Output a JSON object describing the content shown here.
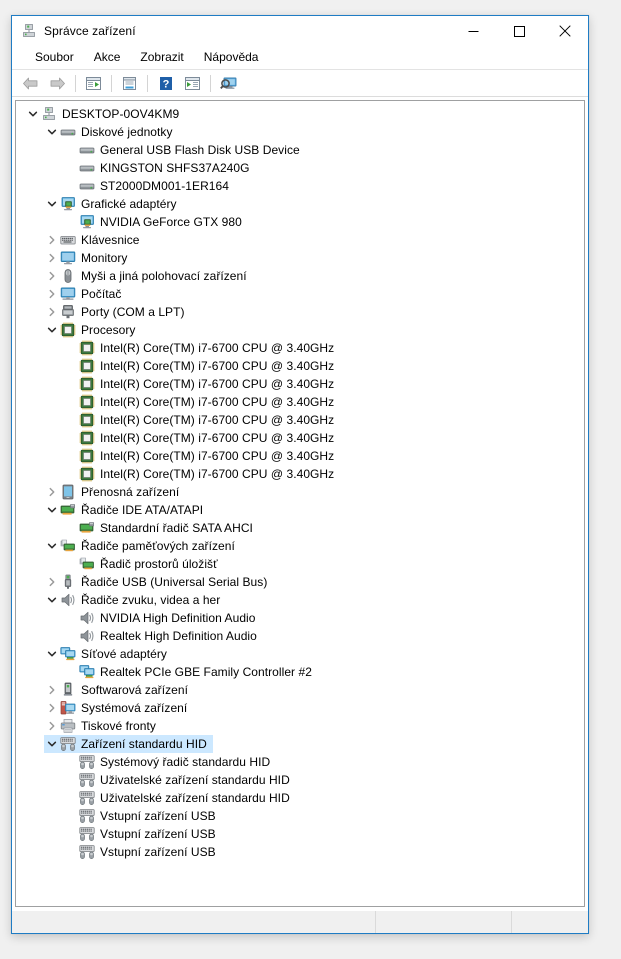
{
  "window": {
    "title": "Správce zařízení",
    "title_icon": "device-manager-icon",
    "minimize_label": "─",
    "maximize_label": "□",
    "close_label": "✕"
  },
  "menu": {
    "items": [
      {
        "label": "Soubor",
        "name": "menu-soubor"
      },
      {
        "label": "Akce",
        "name": "menu-akce"
      },
      {
        "label": "Zobrazit",
        "name": "menu-zobrazit"
      },
      {
        "label": "Nápověda",
        "name": "menu-napoveda"
      }
    ]
  },
  "toolbar": {
    "buttons": [
      {
        "name": "back-button",
        "icon": "back-arrow-icon"
      },
      {
        "name": "forward-button",
        "icon": "forward-arrow-icon"
      },
      {
        "name": "separator-1",
        "icon": "separator"
      },
      {
        "name": "show-hide-console-tree-button",
        "icon": "console-tree-icon"
      },
      {
        "name": "separator-2",
        "icon": "separator"
      },
      {
        "name": "properties-button",
        "icon": "properties-icon"
      },
      {
        "name": "separator-3",
        "icon": "separator"
      },
      {
        "name": "help-button",
        "icon": "help-question-icon"
      },
      {
        "name": "separator-4",
        "icon": "separator"
      },
      {
        "name": "update-driver-button",
        "icon": "update-driver-icon"
      },
      {
        "name": "separator-5",
        "icon": "separator"
      },
      {
        "name": "scan-hardware-changes-button",
        "icon": "scan-hardware-icon"
      }
    ]
  },
  "tree": {
    "items": [
      {
        "label": "DESKTOP-0OV4KM9",
        "level": 0,
        "twisty": "expanded",
        "icon": "computer-icon",
        "selected": false
      },
      {
        "label": "Diskové jednotky",
        "level": 1,
        "twisty": "expanded",
        "icon": "disk-drive-icon",
        "selected": false
      },
      {
        "label": "General USB Flash Disk USB Device",
        "level": 2,
        "twisty": "none",
        "icon": "disk-drive-icon",
        "selected": false
      },
      {
        "label": "KINGSTON SHFS37A240G",
        "level": 2,
        "twisty": "none",
        "icon": "disk-drive-icon",
        "selected": false
      },
      {
        "label": "ST2000DM001-1ER164",
        "level": 2,
        "twisty": "none",
        "icon": "disk-drive-icon",
        "selected": false
      },
      {
        "label": "Grafické adaptéry",
        "level": 1,
        "twisty": "expanded",
        "icon": "display-adapter-icon",
        "selected": false
      },
      {
        "label": "NVIDIA GeForce GTX 980",
        "level": 2,
        "twisty": "none",
        "icon": "display-adapter-icon",
        "selected": false
      },
      {
        "label": "Klávesnice",
        "level": 1,
        "twisty": "collapsed",
        "icon": "keyboard-icon",
        "selected": false
      },
      {
        "label": "Monitory",
        "level": 1,
        "twisty": "collapsed",
        "icon": "monitor-icon",
        "selected": false
      },
      {
        "label": "Myši a jiná polohovací zařízení",
        "level": 1,
        "twisty": "collapsed",
        "icon": "mouse-icon",
        "selected": false
      },
      {
        "label": "Počítač",
        "level": 1,
        "twisty": "collapsed",
        "icon": "computer-node-icon",
        "selected": false
      },
      {
        "label": "Porty (COM a LPT)",
        "level": 1,
        "twisty": "collapsed",
        "icon": "port-icon",
        "selected": false
      },
      {
        "label": "Procesory",
        "level": 1,
        "twisty": "expanded",
        "icon": "processor-icon",
        "selected": false
      },
      {
        "label": "Intel(R) Core(TM) i7-6700 CPU @ 3.40GHz",
        "level": 2,
        "twisty": "none",
        "icon": "processor-icon",
        "selected": false
      },
      {
        "label": "Intel(R) Core(TM) i7-6700 CPU @ 3.40GHz",
        "level": 2,
        "twisty": "none",
        "icon": "processor-icon",
        "selected": false
      },
      {
        "label": "Intel(R) Core(TM) i7-6700 CPU @ 3.40GHz",
        "level": 2,
        "twisty": "none",
        "icon": "processor-icon",
        "selected": false
      },
      {
        "label": "Intel(R) Core(TM) i7-6700 CPU @ 3.40GHz",
        "level": 2,
        "twisty": "none",
        "icon": "processor-icon",
        "selected": false
      },
      {
        "label": "Intel(R) Core(TM) i7-6700 CPU @ 3.40GHz",
        "level": 2,
        "twisty": "none",
        "icon": "processor-icon",
        "selected": false
      },
      {
        "label": "Intel(R) Core(TM) i7-6700 CPU @ 3.40GHz",
        "level": 2,
        "twisty": "none",
        "icon": "processor-icon",
        "selected": false
      },
      {
        "label": "Intel(R) Core(TM) i7-6700 CPU @ 3.40GHz",
        "level": 2,
        "twisty": "none",
        "icon": "processor-icon",
        "selected": false
      },
      {
        "label": "Intel(R) Core(TM) i7-6700 CPU @ 3.40GHz",
        "level": 2,
        "twisty": "none",
        "icon": "processor-icon",
        "selected": false
      },
      {
        "label": "Přenosná zařízení",
        "level": 1,
        "twisty": "collapsed",
        "icon": "portable-device-icon",
        "selected": false
      },
      {
        "label": "Řadiče IDE ATA/ATAPI",
        "level": 1,
        "twisty": "expanded",
        "icon": "ide-controller-icon",
        "selected": false
      },
      {
        "label": "Standardní řadič  SATA AHCI",
        "level": 2,
        "twisty": "none",
        "icon": "ide-controller-icon",
        "selected": false
      },
      {
        "label": "Řadiče paměťových zařízení",
        "level": 1,
        "twisty": "expanded",
        "icon": "storage-controller-icon",
        "selected": false
      },
      {
        "label": "Řadič prostorů úložišť",
        "level": 2,
        "twisty": "none",
        "icon": "storage-controller-icon",
        "selected": false
      },
      {
        "label": "Řadiče USB (Universal Serial Bus)",
        "level": 1,
        "twisty": "collapsed",
        "icon": "usb-controller-icon",
        "selected": false
      },
      {
        "label": "Řadiče zvuku, videa a her",
        "level": 1,
        "twisty": "expanded",
        "icon": "sound-icon",
        "selected": false
      },
      {
        "label": "NVIDIA High Definition Audio",
        "level": 2,
        "twisty": "none",
        "icon": "sound-icon",
        "selected": false
      },
      {
        "label": "Realtek High Definition Audio",
        "level": 2,
        "twisty": "none",
        "icon": "sound-icon",
        "selected": false
      },
      {
        "label": "Síťové adaptéry",
        "level": 1,
        "twisty": "expanded",
        "icon": "network-adapter-icon",
        "selected": false
      },
      {
        "label": "Realtek PCIe GBE Family Controller #2",
        "level": 2,
        "twisty": "none",
        "icon": "network-adapter-icon",
        "selected": false
      },
      {
        "label": "Softwarová zařízení",
        "level": 1,
        "twisty": "collapsed",
        "icon": "software-device-icon",
        "selected": false
      },
      {
        "label": "Systémová zařízení",
        "level": 1,
        "twisty": "collapsed",
        "icon": "system-device-icon",
        "selected": false
      },
      {
        "label": "Tiskové fronty",
        "level": 1,
        "twisty": "collapsed",
        "icon": "printer-icon",
        "selected": false
      },
      {
        "label": "Zařízení standardu HID",
        "level": 1,
        "twisty": "expanded",
        "icon": "hid-icon",
        "selected": true
      },
      {
        "label": "Systémový řadič standardu HID",
        "level": 2,
        "twisty": "none",
        "icon": "hid-icon",
        "selected": false
      },
      {
        "label": "Uživatelské zařízení standardu HID",
        "level": 2,
        "twisty": "none",
        "icon": "hid-icon",
        "selected": false
      },
      {
        "label": "Uživatelské zařízení standardu HID",
        "level": 2,
        "twisty": "none",
        "icon": "hid-icon",
        "selected": false
      },
      {
        "label": "Vstupní zařízení USB",
        "level": 2,
        "twisty": "none",
        "icon": "hid-icon",
        "selected": false
      },
      {
        "label": "Vstupní zařízení USB",
        "level": 2,
        "twisty": "none",
        "icon": "hid-icon",
        "selected": false
      },
      {
        "label": "Vstupní zařízení USB",
        "level": 2,
        "twisty": "none",
        "icon": "hid-icon",
        "selected": false
      }
    ]
  },
  "statusbar": {
    "pane1": "",
    "pane2": "",
    "pane3": ""
  },
  "colors": {
    "window_border": "#1f7cc4",
    "selection": "#cce8ff",
    "tree_border": "#9fa0a1",
    "statusbar_bg": "#f0f0f0",
    "text": "#000000"
  }
}
